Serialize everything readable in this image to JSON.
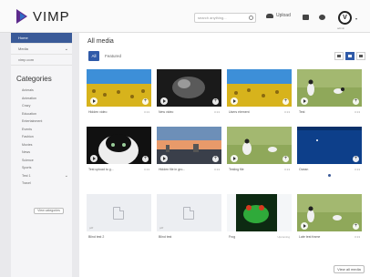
{
  "header": {
    "logo_text": "VIMP",
    "search_placeholder": "search anything...",
    "upload_label": "Upload",
    "avatar_letter": "V",
    "avatar_name": "admin"
  },
  "sidebar": {
    "items": [
      {
        "label": "Home",
        "active": true
      },
      {
        "label": "Media",
        "has_chevron": true
      },
      {
        "label": "vimp.com"
      }
    ],
    "categories_title": "Categories",
    "categories": [
      "Animals",
      "Animation",
      "Crazy",
      "Education",
      "Entertainment",
      "Events",
      "Fashion",
      "Movies",
      "News",
      "Science",
      "Sports",
      "Test 1",
      "Travel"
    ],
    "view_categories_label": "View categories"
  },
  "main": {
    "page_title": "All media",
    "tab_all": "All",
    "tab_featured": "Featured",
    "view_all_label": "View all media"
  },
  "cards": [
    {
      "title": "Hidden video",
      "count": "0:13",
      "type": "video",
      "scene": "sunflowers"
    },
    {
      "title": "New video",
      "count": "0:13",
      "type": "video",
      "scene": "dark"
    },
    {
      "title": "Users element",
      "count": "0:13",
      "type": "video",
      "scene": "sunflowers"
    },
    {
      "title": "Test",
      "count": "0:13",
      "type": "video",
      "scene": "birds"
    },
    {
      "title": "Test upload to g...",
      "count": "0:13",
      "type": "video",
      "scene": "cat"
    },
    {
      "title": "Hidden file in gro...",
      "count": "0:13",
      "type": "video",
      "scene": "sunset"
    },
    {
      "title": "Testing file",
      "count": "0:13",
      "type": "video",
      "scene": "birds"
    },
    {
      "title": "Ocean",
      "count": "0:13",
      "type": "video",
      "scene": "ocean"
    },
    {
      "title": "Blind test 2",
      "count": "",
      "type": "document",
      "doc_label": "pdf"
    },
    {
      "title": "Blind test",
      "count": "",
      "type": "document",
      "doc_label": "pdf"
    },
    {
      "title": "Frog",
      "count": "Upcoming",
      "type": "image",
      "scene": "frog"
    },
    {
      "title": "Late test frame",
      "count": "0:13",
      "type": "video",
      "scene": "birds"
    }
  ]
}
